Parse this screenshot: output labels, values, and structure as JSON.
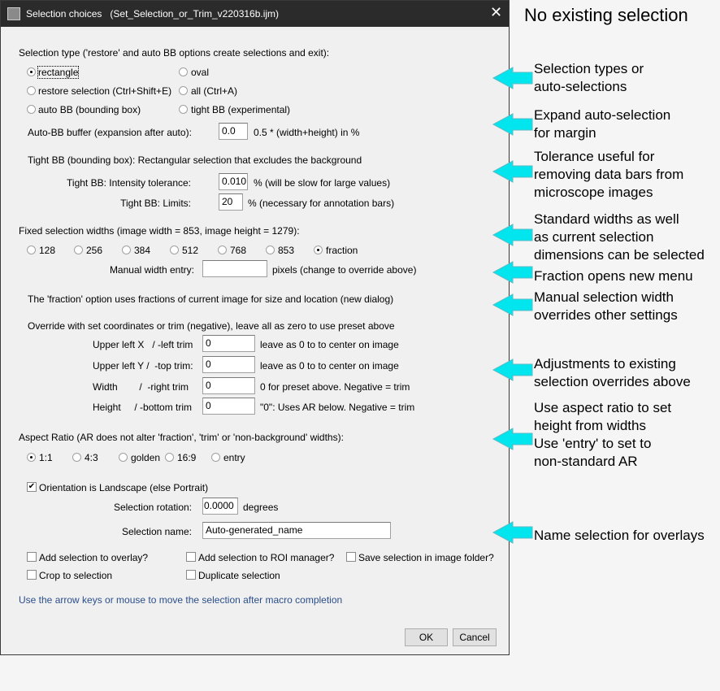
{
  "window": {
    "title": "Selection choices   (Set_Selection_or_Trim_v220316b.ijm)",
    "close_icon": "close-icon"
  },
  "selection_type": {
    "heading": "Selection type ('restore' and auto BB options create selections and exit):",
    "options": [
      "rectangle",
      "oval",
      "restore selection (Ctrl+Shift+E)",
      "all (Ctrl+A)",
      "auto BB (bounding box)",
      "tight BB (experimental)"
    ],
    "selected": "rectangle"
  },
  "auto_bb": {
    "label": "Auto-BB buffer (expansion after auto):",
    "value": "0.0",
    "suffix": "0.5 * (width+height) in %"
  },
  "tight_bb": {
    "heading": "Tight BB (bounding box): Rectangular selection that excludes the background",
    "tol_label": "Tight BB: Intensity tolerance:",
    "tol_value": "0.010",
    "tol_suffix": "% (will be slow for large values)",
    "lim_label": "Tight BB: Limits:",
    "lim_value": "20",
    "lim_suffix": "% (necessary for annotation bars)"
  },
  "widths": {
    "heading": "Fixed selection widths (image width = 853, image height = 1279):",
    "options": [
      "128",
      "256",
      "384",
      "512",
      "768",
      "853",
      "fraction"
    ],
    "selected": "fraction",
    "manual_label": "Manual width entry:",
    "manual_value": "",
    "manual_suffix": "pixels (change to override above)",
    "fraction_note": "The 'fraction' option uses fractions of current image for size and location (new dialog)"
  },
  "override": {
    "heading": "Override with set coordinates or trim (negative), leave all as zero to use preset above",
    "rows": [
      {
        "label": "Upper left X   / -left trim",
        "value": "0",
        "note": "leave as 0 to to center on image"
      },
      {
        "label": "Upper left Y /  -top trim:",
        "value": "0",
        "note": "leave as 0 to to center on image"
      },
      {
        "label": "Width        /  -right trim",
        "value": "0",
        "note": "0 for preset above. Negative = trim"
      },
      {
        "label": "Height     / -bottom trim",
        "value": "0",
        "note": "\"0\": Uses AR below. Negative = trim"
      }
    ]
  },
  "aspect": {
    "heading": "Aspect Ratio (AR does not alter 'fraction', 'trim' or 'non-background' widths):",
    "options": [
      "1:1",
      "4:3",
      "golden",
      "16:9",
      "entry"
    ],
    "selected": "1:1"
  },
  "orientation": {
    "label": "Orientation is Landscape (else Portrait)",
    "checked": true
  },
  "rotation": {
    "label": "Selection rotation:",
    "value": "0.0000",
    "suffix": "degrees"
  },
  "name": {
    "label": "Selection name:",
    "value": "Auto-generated_name"
  },
  "checks": [
    {
      "label": "Add selection to overlay?",
      "checked": false
    },
    {
      "label": "Add selection to ROI manager?",
      "checked": false
    },
    {
      "label": "Save selection in image folder?",
      "checked": false
    },
    {
      "label": "Crop to selection",
      "checked": false
    },
    {
      "label": "Duplicate selection",
      "checked": false
    }
  ],
  "hint": "Use the arrow keys or mouse to move the selection after macro completion",
  "buttons": {
    "ok": "OK",
    "cancel": "Cancel"
  },
  "annotations": {
    "header": "No existing selection",
    "items": [
      "Selection types or\nauto-selections",
      "Expand auto-selection\nfor margin",
      "Tolerance useful for\nremoving data bars from\nmicroscope images",
      "Standard widths as well\nas current selection\ndimensions can be selected",
      "Fraction opens new menu",
      "Manual selection width\noverrides other settings",
      "Adjustments to existing\nselection overrides above",
      "Use aspect ratio to set\nheight from widths\nUse 'entry' to set to\nnon-standard AR",
      "Name selection for overlays"
    ],
    "arrow_color": "#00e5ee"
  }
}
